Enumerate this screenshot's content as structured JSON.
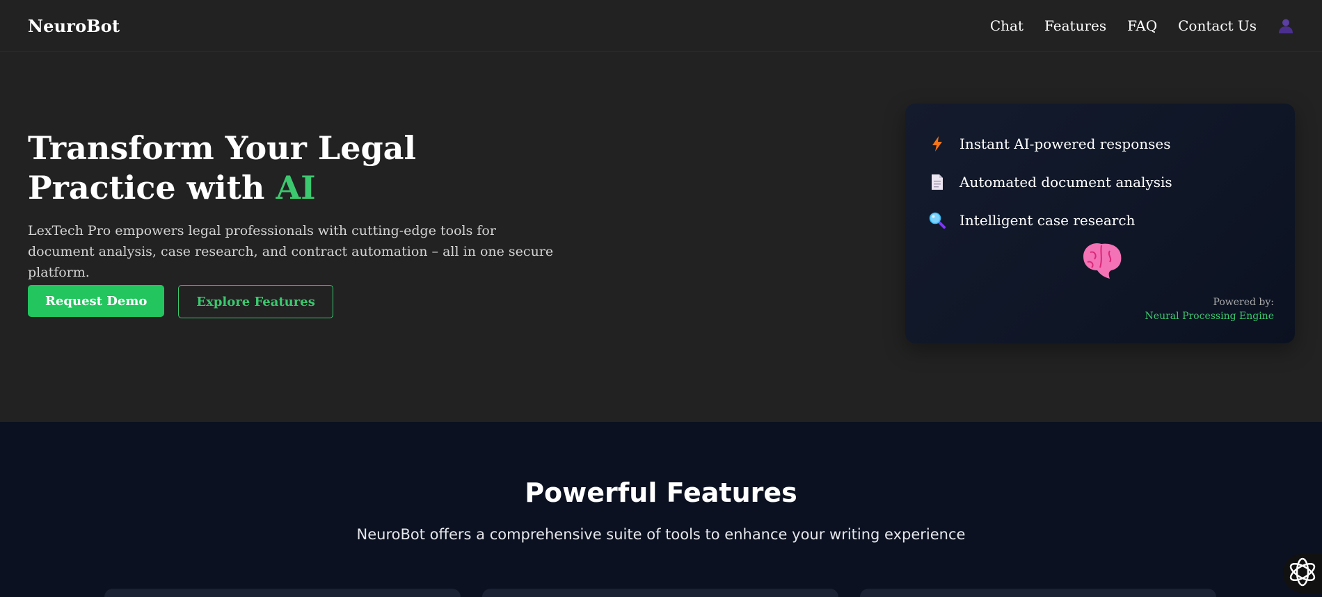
{
  "header": {
    "brand": "NeuroBot",
    "nav": [
      {
        "label": "Chat"
      },
      {
        "label": "Features"
      },
      {
        "label": "FAQ"
      },
      {
        "label": "Contact Us"
      }
    ],
    "user_icon": "user-icon"
  },
  "hero": {
    "title_part1": "Transform Your Legal Practice with",
    "title_accent": "AI",
    "subtitle": "LexTech Pro empowers legal professionals with cutting-edge tools for document analysis, case research, and contract automation – all in one secure platform.",
    "primary_button": "Request Demo",
    "secondary_button": "Explore Features"
  },
  "card": {
    "items": [
      {
        "icon": "lightning-icon",
        "label": "Instant AI-powered responses"
      },
      {
        "icon": "document-icon",
        "label": "Automated document analysis"
      },
      {
        "icon": "magnifier-icon",
        "label": "Intelligent case research"
      }
    ],
    "illustration": "brain-icon",
    "powered_label": "Powered by:",
    "powered_value": "Neural Processing Engine"
  },
  "features": {
    "title": "Powerful Features",
    "subtitle": "NeuroBot offers a comprehensive suite of tools to enhance your writing experience"
  },
  "floating_button": {
    "icon": "openai-logo-icon"
  },
  "colors": {
    "accent": "#22c55e",
    "background": "#222222",
    "features_background": "#0b1120"
  }
}
